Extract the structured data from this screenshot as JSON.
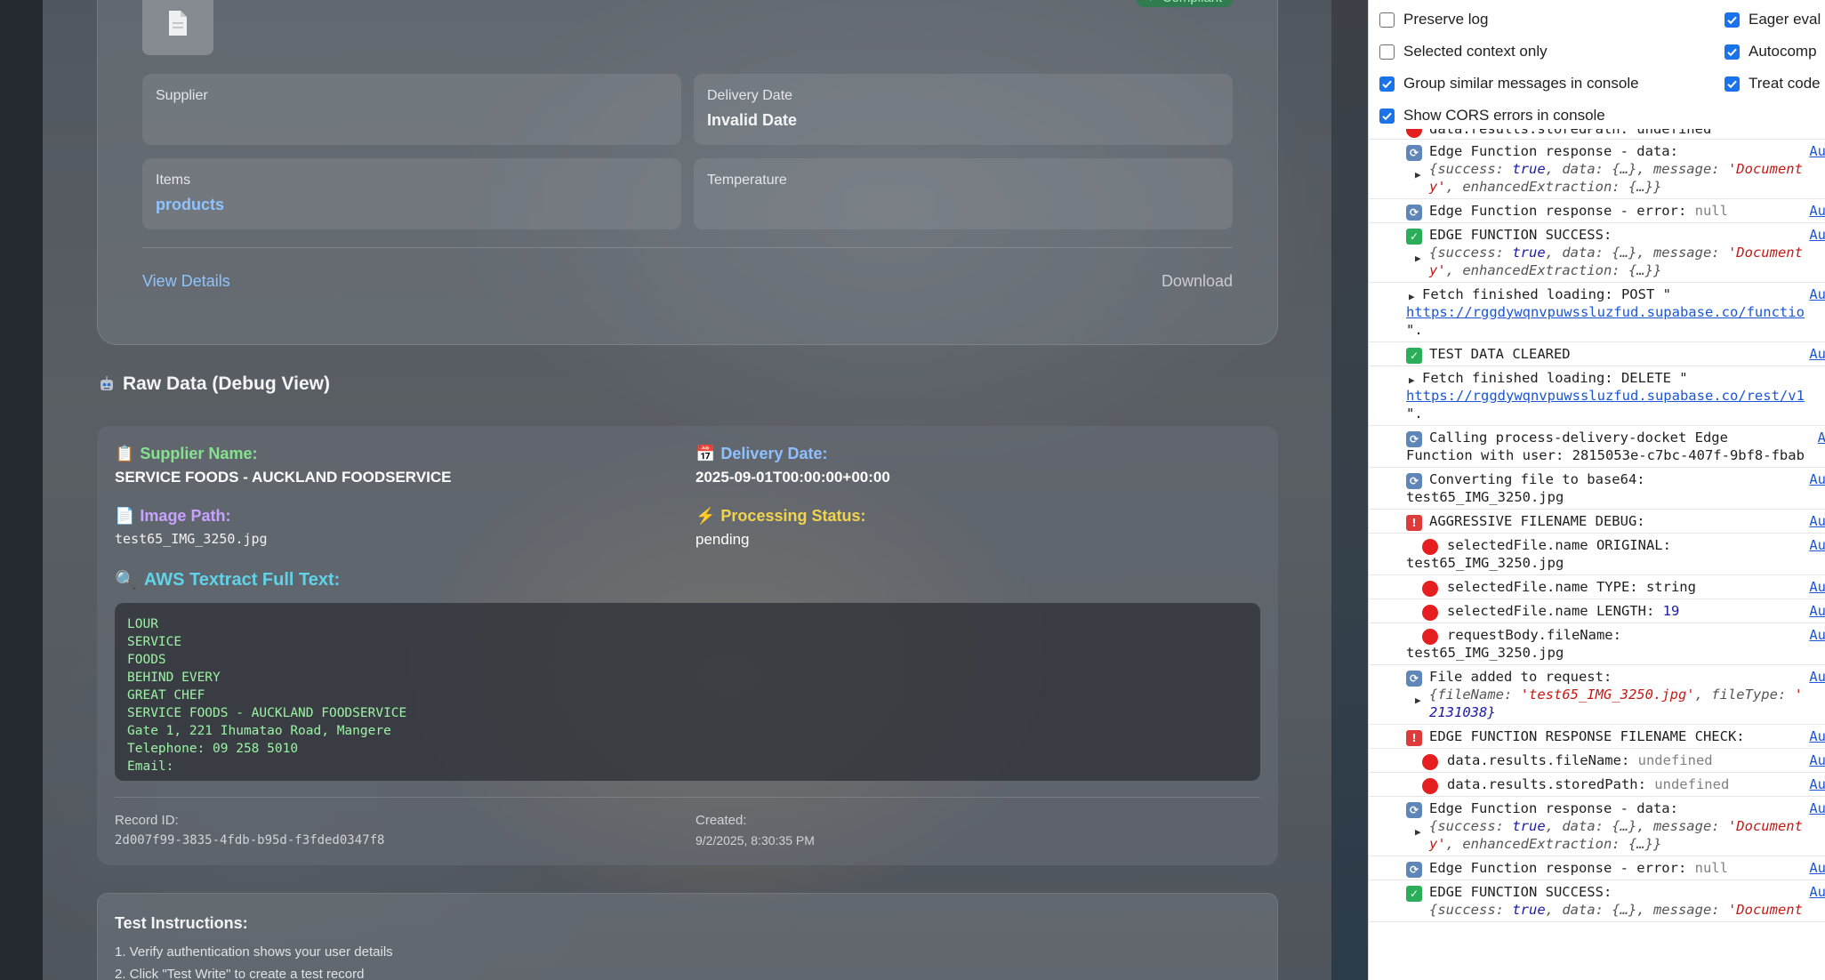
{
  "top_card": {
    "compliant_label": "✓ Compliant",
    "supplier_label": "Supplier",
    "supplier_value": "",
    "delivery_label": "Delivery Date",
    "delivery_value": "Invalid Date",
    "items_label": "Items",
    "items_value": "products",
    "temperature_label": "Temperature",
    "temperature_value": "",
    "view_details": "View Details",
    "download": "Download"
  },
  "raw": {
    "title": "Raw Data (Debug View)",
    "supplier_name_label": "Supplier Name:",
    "supplier_name_value": "SERVICE FOODS - AUCKLAND FOODSERVICE",
    "delivery_date_label": "Delivery Date:",
    "delivery_date_value": "2025-09-01T00:00:00+00:00",
    "image_path_label": "Image Path:",
    "image_path_value": "test65_IMG_3250.jpg",
    "processing_status_label": "Processing Status:",
    "processing_status_value": "pending",
    "aws_title": "AWS Textract Full Text:",
    "textract_lines": [
      "LOUR",
      "SERVICE",
      "FOODS",
      "BEHIND EVERY",
      "GREAT CHEF",
      "SERVICE FOODS - AUCKLAND FOODSERVICE",
      "Gate 1, 221 Ihumatao Road, Mangere",
      "Telephone: 09 258 5010",
      "Email:"
    ],
    "record_id_label": "Record ID:",
    "record_id_value": "2d007f99-3835-4fdb-b95d-f3fded0347f8",
    "created_label": "Created:",
    "created_value": "9/2/2025, 8:30:35 PM"
  },
  "instructions": {
    "title": "Test Instructions:",
    "items": [
      "1. Verify authentication shows your user details",
      "2. Click \"Test Write\" to create a test record"
    ]
  },
  "console_settings": {
    "preserve_log": "Preserve log",
    "selected_context": "Selected context only",
    "group_similar": "Group similar messages in console",
    "show_cors": "Show CORS errors in console",
    "eager_eval": "Eager eval",
    "autocomplete": "Autocomp",
    "treat_code": "Treat code"
  },
  "console": {
    "src": "Au",
    "m1_text": "Edge Function response - data:",
    "obj_success_line1a": "{success: ",
    "obj_true": "true",
    "obj_success_line1b": ", data: {…}, message: ",
    "obj_docstr": "'Document",
    "obj_line2a": "y'",
    "obj_line2b": ", enhancedExtraction: {…}}",
    "m2_text": "Edge Function response - error: ",
    "null": "null",
    "m3_text": "EDGE FUNCTION SUCCESS:",
    "m4_text": "Fetch finished loading: POST \"",
    "m4_url": "https://rggdywqnvpuwssluzfud.supabase.co/functio",
    "m4_tail": "\".",
    "m5_text": "TEST DATA CLEARED",
    "m6_text": "Fetch finished loading: DELETE \"",
    "m6_url": "https://rggdywqnvpuwssluzfud.supabase.co/rest/v1",
    "m7_text": "Calling process-delivery-docket Edge",
    "m7_text2": "Function with user: 2815053e-c7bc-407f-9bf8-fbab",
    "m7_src": "A",
    "m8_text": "Converting file to base64:",
    "m8_text2": "test65_IMG_3250.jpg",
    "m9_text": "AGGRESSIVE FILENAME DEBUG:",
    "m10_text": "selectedFile.name ORIGINAL:",
    "m10_text2": "test65_IMG_3250.jpg",
    "m11_text": "selectedFile.name TYPE: string",
    "m12_text": "selectedFile.name LENGTH: ",
    "m12_num": "19",
    "m13_text": "requestBody.fileName:",
    "m13_text2": "test65_IMG_3250.jpg",
    "m14_text": "File added to request:",
    "m14_obj_a": "{fileName: ",
    "m14_obj_str": "'test65_IMG_3250.jpg'",
    "m14_obj_b": ", fileType: ",
    "m14_obj_c": "'",
    "m14_line2": "2131038}",
    "m15_text": "EDGE FUNCTION RESPONSE FILENAME CHECK:",
    "m16_text": "data.results.fileName: ",
    "m17_text": "data.results.storedPath: ",
    "undefined": "undefined",
    "top_partial": "data.results.storedPath: undefined"
  }
}
